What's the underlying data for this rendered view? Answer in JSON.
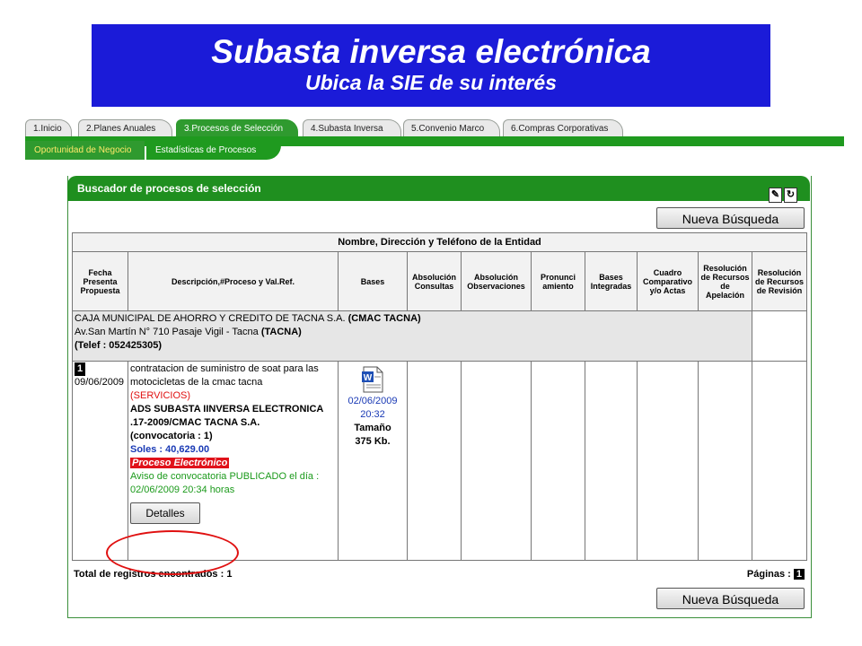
{
  "banner": {
    "title": "Subasta inversa electrónica",
    "subtitle": "Ubica la SIE de su interés"
  },
  "tabs": [
    {
      "label": "1.Inicio"
    },
    {
      "label": "2.Planes Anuales"
    },
    {
      "label": "3.Procesos de Selección"
    },
    {
      "label": "4.Subasta Inversa"
    },
    {
      "label": "5.Convenio Marco"
    },
    {
      "label": "6.Compras Corporativas"
    }
  ],
  "subtabs": [
    {
      "label": "Oportunidad de Negocio"
    },
    {
      "label": "Estadísticas de Procesos"
    }
  ],
  "panel": {
    "title": "Buscador de procesos de selección",
    "new_search": "Nueva Búsqueda",
    "table_title": "Nombre, Dirección y Teléfono de la Entidad",
    "headers": {
      "fecha": "Fecha Presenta Propuesta",
      "descripcion": "Descripción,#Proceso y Val.Ref.",
      "bases": "Bases",
      "absconsultas": "Absolución Consultas",
      "absobs": "Absolución Observaciones",
      "pronunciamiento": "Pronunci amiento",
      "basesint": "Bases Integradas",
      "cuadro": "Cuadro Comparativo y/o Actas",
      "resapel": "Resolución de Recursos de Apelación",
      "resrev": "Resolución de Recursos de Revisión"
    },
    "entity": {
      "name": "CAJA MUNICIPAL DE AHORRO Y CREDITO DE TACNA S.A.",
      "abbr": "(CMAC TACNA)",
      "address": "Av.San Martín N° 710 Pasaje Vigil - Tacna",
      "city": "(TACNA)",
      "phone": "(Telef : 052425305)"
    },
    "row": {
      "num": "1",
      "date": "09/06/2009",
      "desc": "contratacion de suministro de soat para las motocicletas de la cmac tacna",
      "type": "(SERVICIOS)",
      "process": "ADS SUBASTA IINVERSA ELECTRONICA .17-2009/CMAC TACNA S.A.",
      "convocatoria": "(convocatoria : 1)",
      "value": "Soles : 40,629.00",
      "electronic": "Proceso Electrónico",
      "notice": "Aviso de convocatoria PUBLICADO el día : 02/06/2009 20:34 horas",
      "details_btn": "Detalles",
      "bases_date": "02/06/2009",
      "bases_time": "20:32",
      "bases_size_label": "Tamaño",
      "bases_size": "375 Kb."
    },
    "footer": {
      "total": "Total de registros encontrados : 1",
      "pages_label": "Páginas :",
      "page": "1"
    }
  },
  "colors": {
    "banner_bg": "#1b1bd8",
    "green": "#1f9a1f",
    "highlight_ellipse": "#e01010"
  },
  "icons": [
    "pencil-icon",
    "refresh-icon",
    "word-document-icon"
  ]
}
